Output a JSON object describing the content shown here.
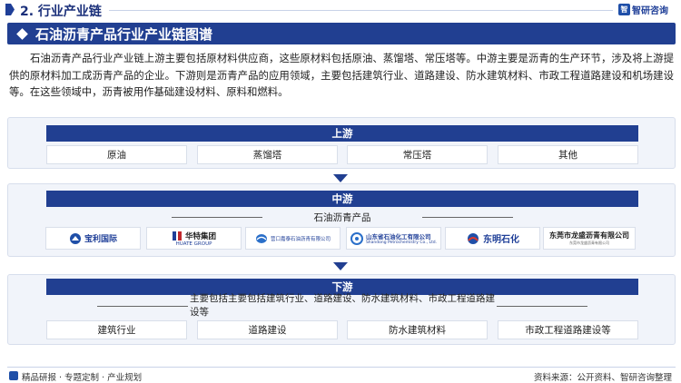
{
  "header": {
    "section_title": "2. 行业产业链",
    "logo_text": "智研咨询"
  },
  "title": "石油沥青产品行业产业链图谱",
  "intro": "石油沥青产品行业产业链上游主要包括原材料供应商，这些原材料包括原油、蒸馏塔、常压塔等。中游主要是沥青的生产环节，涉及将上游提供的原材料加工成沥青产品的企业。下游则是沥青产品的应用领域，主要包括建筑行业、道路建设、防水建筑材料、市政工程道路建设和机场建设等。在这些领域中，沥青被用作基础建设材料、原料和燃料。",
  "upstream": {
    "header": "上游",
    "items": [
      "原油",
      "蒸馏塔",
      "常压塔",
      "其他"
    ]
  },
  "midstream": {
    "header": "中游",
    "subtitle": "石油沥青产品",
    "companies": [
      {
        "name": "宝利国际",
        "icon": "baoli-logo"
      },
      {
        "name": "华特集团",
        "sub": "HUATE GROUP",
        "icon": "huate-logo"
      },
      {
        "name": "营口嘉泰石油沥青有限公司",
        "icon": "yingkou-logo"
      },
      {
        "name": "山东省石油化工有限公司",
        "sub": "Shandong Petrochemistry Co., Ltd.",
        "icon": "shandong-petro-logo"
      },
      {
        "name": "东明石化",
        "icon": "dongming-logo"
      },
      {
        "name": "东莞市龙盛沥青有限公司",
        "sub": "东莞市龙盛沥青有限公司",
        "icon": "longsheng-logo"
      }
    ]
  },
  "downstream": {
    "header": "下游",
    "subtitle": "主要包括主要包括建筑行业、道路建设、防水建筑材料、市政工程道路建设等",
    "items": [
      "建筑行业",
      "道路建设",
      "防水建筑材料",
      "市政工程道路建设等"
    ]
  },
  "footer": {
    "left": "精品研报 · 专题定制 · 产业规划",
    "right": "资料来源：公开资料、智研咨询整理"
  },
  "colors": {
    "primary": "#213f91",
    "panel_bg": "#f1f4fa"
  }
}
